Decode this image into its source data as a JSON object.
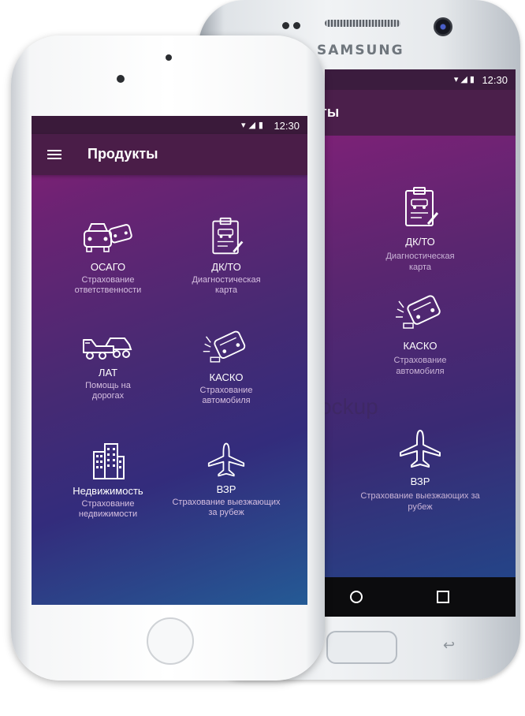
{
  "samsung": {
    "brand": "SAMSUNG",
    "status_time": "12:30",
    "title_fragment": "ты",
    "items": [
      {
        "label": "ДК/ТО",
        "sub": "Диагностическая карта",
        "icon": "inspection-card-icon"
      },
      {
        "label": "КАСКО",
        "sub": "Страхование автомобиля",
        "icon": "crashed-car-icon"
      },
      {
        "label": "ВЗР",
        "sub": "Страхование выезжающих за рубеж",
        "icon": "airplane-icon"
      }
    ],
    "watermark": "ockup"
  },
  "iphone": {
    "status_time": "12:30",
    "title": "Продукты",
    "items": [
      {
        "label": "ОСАГО",
        "sub": "Страхование ответственности",
        "icon": "car-collision-icon"
      },
      {
        "label": "ДК/ТО",
        "sub": "Диагностическая карта",
        "icon": "inspection-card-icon"
      },
      {
        "label": "ЛАТ",
        "sub": "Помощь на дорогах",
        "icon": "tow-truck-icon"
      },
      {
        "label": "КАСКО",
        "sub": "Страхование автомобиля",
        "icon": "crashed-car-icon"
      },
      {
        "label": "Недвижимость",
        "sub": "Страхование недвижимости",
        "icon": "buildings-icon"
      },
      {
        "label": "ВЗР",
        "sub": "Страхование выезжающих за рубеж",
        "icon": "airplane-icon"
      }
    ]
  },
  "colors": {
    "appbar": "#4a1d48",
    "gradient_top": "#8a1f78",
    "gradient_bottom": "#245a95"
  }
}
